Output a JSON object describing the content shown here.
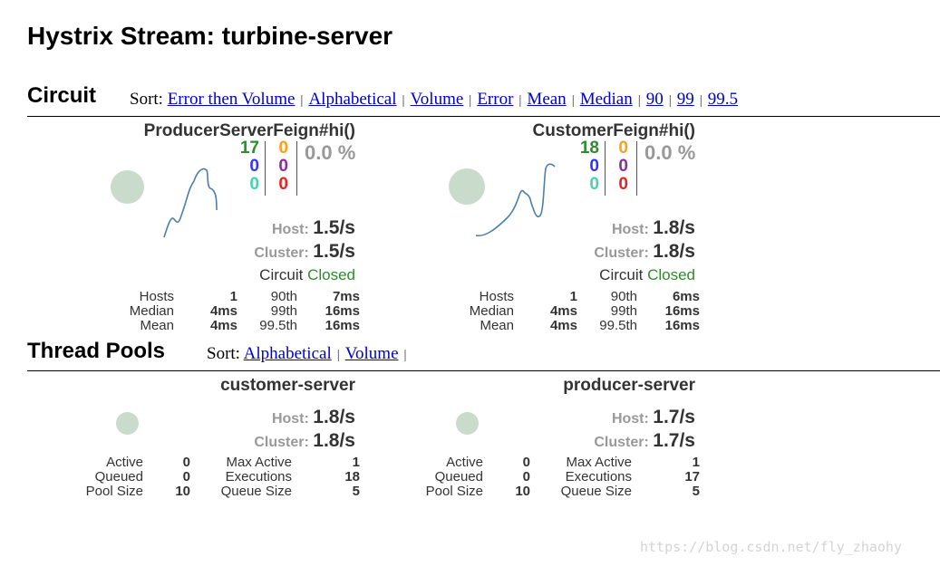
{
  "page": {
    "title": "Hystrix Stream: turbine-server"
  },
  "circuit_section": {
    "title": "Circuit",
    "sort_label": "Sort:",
    "sort_options": [
      "Error then Volume",
      "Alphabetical",
      "Volume",
      "Error",
      "Mean",
      "Median",
      "90",
      "99",
      "99.5"
    ]
  },
  "circuits": [
    {
      "name": "ProducerServerFeign#hi()",
      "counts": {
        "success": "17",
        "short_circuited": "0",
        "bad_request": "0",
        "timeout": "0",
        "rejected": "0",
        "failure": "0"
      },
      "error_pct": "0.0 %",
      "host_label": "Host:",
      "host_rate": "1.5/s",
      "cluster_label": "Cluster:",
      "cluster_rate": "1.5/s",
      "circuit_label": "Circuit",
      "circuit_state": "Closed",
      "stats": {
        "hosts_label": "Hosts",
        "hosts": "1",
        "median_label": "Median",
        "median": "4ms",
        "mean_label": "Mean",
        "mean": "4ms",
        "p90_label": "90th",
        "p90": "7ms",
        "p99_label": "99th",
        "p99": "16ms",
        "p995_label": "99.5th",
        "p995": "16ms"
      }
    },
    {
      "name": "CustomerFeign#hi()",
      "counts": {
        "success": "18",
        "short_circuited": "0",
        "bad_request": "0",
        "timeout": "0",
        "rejected": "0",
        "failure": "0"
      },
      "error_pct": "0.0 %",
      "host_label": "Host:",
      "host_rate": "1.8/s",
      "cluster_label": "Cluster:",
      "cluster_rate": "1.8/s",
      "circuit_label": "Circuit",
      "circuit_state": "Closed",
      "stats": {
        "hosts_label": "Hosts",
        "hosts": "1",
        "median_label": "Median",
        "median": "4ms",
        "mean_label": "Mean",
        "mean": "4ms",
        "p90_label": "90th",
        "p90": "6ms",
        "p99_label": "99th",
        "p99": "16ms",
        "p995_label": "99.5th",
        "p995": "16ms"
      }
    }
  ],
  "thread_section": {
    "title": "Thread Pools",
    "sort_label": "Sort:",
    "sort_options": [
      "Alphabetical",
      "Volume"
    ]
  },
  "thread_pools": [
    {
      "name": "customer-server",
      "host_label": "Host:",
      "host_rate": "1.8/s",
      "cluster_label": "Cluster:",
      "cluster_rate": "1.8/s",
      "stats": {
        "active_label": "Active",
        "active": "0",
        "queued_label": "Queued",
        "queued": "0",
        "pool_size_label": "Pool Size",
        "pool_size": "10",
        "max_active_label": "Max Active",
        "max_active": "1",
        "executions_label": "Executions",
        "executions": "18",
        "queue_size_label": "Queue Size",
        "queue_size": "5"
      }
    },
    {
      "name": "producer-server",
      "host_label": "Host:",
      "host_rate": "1.7/s",
      "cluster_label": "Cluster:",
      "cluster_rate": "1.7/s",
      "stats": {
        "active_label": "Active",
        "active": "0",
        "queued_label": "Queued",
        "queued": "0",
        "pool_size_label": "Pool Size",
        "pool_size": "10",
        "max_active_label": "Max Active",
        "max_active": "1",
        "executions_label": "Executions",
        "executions": "17",
        "queue_size_label": "Queue Size",
        "queue_size": "5"
      }
    }
  ],
  "colors": {
    "success": "#2e8b2e",
    "short_circuited": "#3333ff",
    "bad_request": "#44d4b0",
    "timeout": "#ff9f1a",
    "rejected": "#8b2e99",
    "failure": "#e32424",
    "circle_fill": "#c9dccb",
    "sparkline": "#4d7fa8"
  },
  "watermark": "https://blog.csdn.net/fly_zhaohy"
}
